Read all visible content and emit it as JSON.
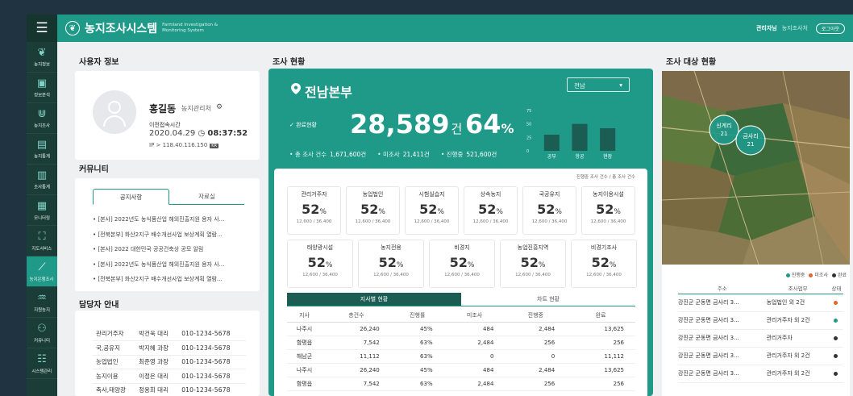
{
  "app": {
    "title": "농지조사시스템",
    "subtitle": "Farmland Investigation & Monitoring System",
    "menu_icon": "hamburger-icon",
    "brand_color": "#1f9a89"
  },
  "header": {
    "user_name": "관리자님",
    "user_role": "농지조사처",
    "logout": "로그아웃"
  },
  "sidebar": {
    "items": [
      {
        "label": "농지정보",
        "icon": "sprout-icon"
      },
      {
        "label": "정보분석",
        "icon": "monitor-chart-icon"
      },
      {
        "label": "농지조사",
        "icon": "field-rows-icon"
      },
      {
        "label": "농지통계",
        "icon": "document-stats-icon"
      },
      {
        "label": "조사통계",
        "icon": "bar-chart-icon"
      },
      {
        "label": "모니터링",
        "icon": "building-chart-icon"
      },
      {
        "label": "지도서비스",
        "icon": "map-person-icon"
      },
      {
        "label": "농지은행조사",
        "icon": "line-chart-icon"
      },
      {
        "label": "지원농지",
        "icon": "hands-icon"
      },
      {
        "label": "커뮤니티",
        "icon": "people-icon"
      },
      {
        "label": "시스템관리",
        "icon": "server-icon"
      }
    ]
  },
  "profile": {
    "section_title": "사용자 정보",
    "name": "홍길동",
    "role": "농지관리처",
    "last_access_label": "이전접속시간",
    "date": "2020.04.29",
    "time": "08:37:52",
    "ip": "IP > 118.40.116.150",
    "ip_badge": "KR"
  },
  "community": {
    "section_title": "커뮤니티",
    "tabs": [
      "공지사항",
      "자료실"
    ],
    "items": [
      "[본사] 2022년도 농식품산업 해외진출지원 용자 사...",
      "[전북본부] 화산2지구 배수개선사업 보상계획 열람...",
      "[본사] 2022 대한민국 공공건축상 공모 알림",
      "[본사] 2022년도 농식품산업 해외진출지원 용자 사...",
      "[전북본부] 화산2지구 배수개선사업 보상계획 열람..."
    ]
  },
  "managers": {
    "section_title": "담당자 안내",
    "rows": [
      [
        "관리거주자",
        "박건욱 대리",
        "010-1234-5678"
      ],
      [
        "국,공유지",
        "박지혜 과장",
        "010-1234-5678"
      ],
      [
        "농업법인",
        "최준영 과장",
        "010-1234-5678"
      ],
      [
        "농지이용",
        "이정은 대리",
        "010-1234-5678"
      ],
      [
        "축사,태양광",
        "정용희 대리",
        "010-1234-5678"
      ]
    ]
  },
  "status": {
    "section_title": "조사 현황",
    "region": "전남본부",
    "region_select": "전남",
    "done_label": "완료현황",
    "done_count": "28,589",
    "done_unit": "건",
    "done_pct": "64",
    "total_label": "총 조사 건수",
    "total_value": "1,671,600건",
    "pending_label": "미조사",
    "pending_value": "21,411건",
    "progress_label": "진행중",
    "progress_value": "521,600건",
    "legend_note": "진행중 조사 건수 / 총 조사 건수",
    "categories": [
      {
        "name": "관리거주자",
        "pct": "52",
        "sub": "12,600 / 36,400"
      },
      {
        "name": "농업법인",
        "pct": "52",
        "sub": "12,600 / 36,400"
      },
      {
        "name": "시험실습지",
        "pct": "52",
        "sub": "12,600 / 36,400"
      },
      {
        "name": "상속농지",
        "pct": "52",
        "sub": "12,600 / 36,400"
      },
      {
        "name": "국공유지",
        "pct": "52",
        "sub": "12,600 / 36,400"
      },
      {
        "name": "농지이용시설",
        "pct": "52",
        "sub": "12,600 / 36,400"
      },
      {
        "name": "태양광시설",
        "pct": "52",
        "sub": "12,600 / 36,400"
      },
      {
        "name": "농지전용",
        "pct": "52",
        "sub": "12,600 / 36,400"
      },
      {
        "name": "비경지",
        "pct": "52",
        "sub": "12,600 / 36,400"
      },
      {
        "name": "농업진흥지역",
        "pct": "52",
        "sub": "12,600 / 36,400"
      },
      {
        "name": "비경기조사",
        "pct": "52",
        "sub": "12,600 / 36,400"
      }
    ],
    "table_tabs": [
      "지사별 현황",
      "차트 현황"
    ],
    "table_headers": [
      "지사",
      "총건수",
      "진행률",
      "미조사",
      "진행중",
      "완료"
    ],
    "table_rows": [
      [
        "나주시",
        "26,240",
        "45%",
        "484",
        "2,484",
        "13,625"
      ],
      [
        "함평읍",
        "7,542",
        "63%",
        "2,484",
        "256",
        "256"
      ],
      [
        "해남군",
        "11,112",
        "63%",
        "0",
        "0",
        "11,112"
      ],
      [
        "나주시",
        "26,240",
        "45%",
        "484",
        "2,484",
        "13,625"
      ],
      [
        "함평읍",
        "7,542",
        "63%",
        "2,484",
        "256",
        "256"
      ]
    ]
  },
  "chart_data": {
    "type": "bar",
    "categories": [
      "공부",
      "항공",
      "현장"
    ],
    "values": [
      30,
      50,
      42
    ],
    "ylim": [
      0,
      75
    ],
    "yticks": [
      0,
      25,
      50,
      75
    ],
    "bar_color": "#1b5c53"
  },
  "target": {
    "section_title": "조사 대상 현황",
    "map_labels": [
      {
        "name": "신계리",
        "count": "21"
      },
      {
        "name": "금사리",
        "count": "21"
      }
    ],
    "legend": [
      {
        "label": "진행중",
        "color": "#1f9a89"
      },
      {
        "label": "미조사",
        "color": "#e0662b"
      },
      {
        "label": "완료",
        "color": "#333333"
      }
    ],
    "headers": [
      "주소",
      "조사업무",
      "상태"
    ],
    "rows": [
      {
        "addr": "강진군 군동면 금사리 3...",
        "task": "농업법인 외 2건",
        "color": "#e0662b"
      },
      {
        "addr": "강진군 군동면 금사리 3...",
        "task": "관리거주자 외 2건",
        "color": "#1f9a89"
      },
      {
        "addr": "강진군 군동면 금사리 3...",
        "task": "관리거주자",
        "color": "#333333"
      },
      {
        "addr": "강진군 군동면 금사리 3...",
        "task": "관리거주자 외 2건",
        "color": "#333333"
      },
      {
        "addr": "강진군 군동면 금사리 3...",
        "task": "관리거주자 외 2건",
        "color": "#333333"
      }
    ]
  }
}
